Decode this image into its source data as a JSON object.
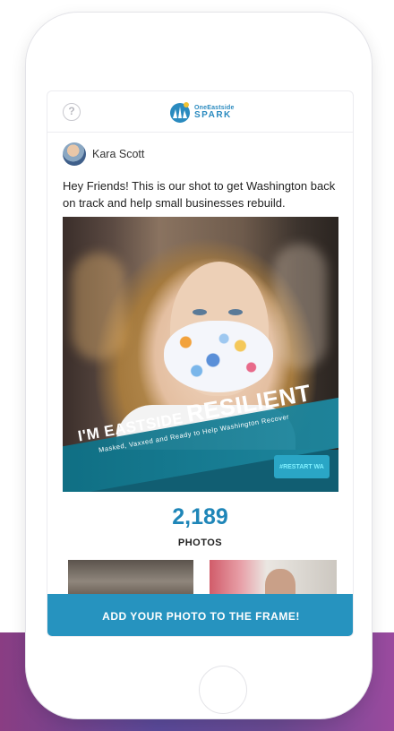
{
  "header": {
    "logo_line1": "OneEastside",
    "logo_line2": "SPARK",
    "help_icon": "question-circle-icon"
  },
  "post": {
    "author": "Kara Scott",
    "message": "Hey Friends! This is our shot to get Washington back on track and help small businesses rebuild.",
    "frame": {
      "banner_prefix": "I'M EASTSIDE",
      "banner_main": "RESILIENT",
      "banner_sub": "Masked, Vaxxed and Ready to Help Washington Recover",
      "hashtag": "#RESTART WA"
    }
  },
  "stats": {
    "count": "2,189",
    "label": "PHOTOS"
  },
  "cta": {
    "label": "ADD YOUR PHOTO TO THE FRAME!"
  },
  "colors": {
    "accent": "#2693bf",
    "count": "#1f86b8"
  }
}
